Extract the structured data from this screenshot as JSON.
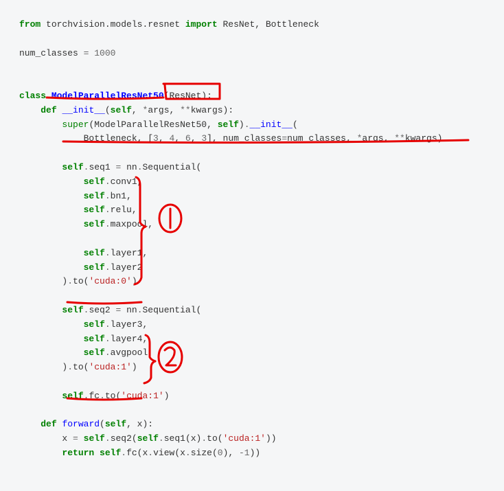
{
  "code": {
    "l1_from": "from",
    "l1_mod": " torchvision.models.resnet ",
    "l1_import": "import",
    "l1_names": " ResNet, Bottleneck",
    "l3_a": "num_classes ",
    "l3_eq": "=",
    "l3_sp": " ",
    "l3_v": "1000",
    "l6_class": "class",
    "l6_sp1": " ",
    "l6_name": "ModelParallelResNet50",
    "l6_paren_o": "(",
    "l6_base": "ResNet",
    "l6_paren_c": ")",
    "l6_colon": ":",
    "l7_indent": "    ",
    "l7_def": "def",
    "l7_sp": " ",
    "l7_init": "__init__",
    "l7_sig_o": "(",
    "l7_self": "self",
    "l7_rest": ", ",
    "l7_star": "*",
    "l7_args": "args, ",
    "l7_dstar": "**",
    "l7_kwargs": "kwargs):",
    "l8_indent": "        ",
    "l8_super": "super",
    "l8_po": "(",
    "l8_cls": "ModelParallelResNet50",
    "l8_mid": ", ",
    "l8_self": "self",
    "l8_pc": ")",
    "l8_dot": ".",
    "l8_init": "__init__",
    "l8_po2": "(",
    "l9_indent": "            ",
    "l9_bottle": "Bottleneck, [",
    "l9_n3": "3",
    "l9_c1": ", ",
    "l9_n4": "4",
    "l9_c2": ", ",
    "l9_n6": "6",
    "l9_c3": ", ",
    "l9_n3b": "3",
    "l9_close": "], num_classes",
    "l9_eq": "=",
    "l9_nc": "num_classes, ",
    "l9_star": "*",
    "l9_args": "args, ",
    "l9_dstar": "**",
    "l9_kwargs": "kwargs)",
    "l11_indent": "        ",
    "l11_self": "self",
    "l11_dot": ".",
    "l11_seq": "seq1 ",
    "l11_eq": "=",
    "l11_r": " nn",
    "l11_dot2": ".",
    "l11_seqfn": "Sequential(",
    "l12_i": "            ",
    "l12_self": "self",
    "l12_d": ".",
    "l12_a": "conv1,",
    "l13_i": "            ",
    "l13_self": "self",
    "l13_d": ".",
    "l13_a": "bn1,",
    "l14_i": "            ",
    "l14_self": "self",
    "l14_d": ".",
    "l14_a": "relu,",
    "l15_i": "            ",
    "l15_self": "self",
    "l15_d": ".",
    "l15_a": "maxpool,",
    "l17_i": "            ",
    "l17_self": "self",
    "l17_d": ".",
    "l17_a": "layer1,",
    "l18_i": "            ",
    "l18_self": "self",
    "l18_d": ".",
    "l18_a": "layer2",
    "l19_i": "        )",
    "l19_d": ".",
    "l19_to": "to(",
    "l19_s": "'cuda:0'",
    "l19_c": ")",
    "l21_i": "        ",
    "l21_self": "self",
    "l21_d": ".",
    "l21_seq": "seq2 ",
    "l21_eq": "=",
    "l21_r": " nn",
    "l21_d2": ".",
    "l21_seqfn": "Sequential(",
    "l22_i": "            ",
    "l22_self": "self",
    "l22_d": ".",
    "l22_a": "layer3,",
    "l23_i": "            ",
    "l23_self": "self",
    "l23_d": ".",
    "l23_a": "layer4,",
    "l24_i": "            ",
    "l24_self": "self",
    "l24_d": ".",
    "l24_a": "avgpool,",
    "l25_i": "        )",
    "l25_d": ".",
    "l25_to": "to(",
    "l25_s": "'cuda:1'",
    "l25_c": ")",
    "l27_i": "        ",
    "l27_self": "self",
    "l27_d": ".",
    "l27_fc": "fc",
    "l27_d2": ".",
    "l27_to": "to(",
    "l27_s": "'cuda:1'",
    "l27_c": ")",
    "l29_i": "    ",
    "l29_def": "def",
    "l29_sp": " ",
    "l29_fwd": "forward",
    "l29_po": "(",
    "l29_self": "self",
    "l29_rest": ", x):",
    "l30_i": "        ",
    "l30_x": "x ",
    "l30_eq": "=",
    "l30_sp": " ",
    "l30_self": "self",
    "l30_d": ".",
    "l30_s2": "seq2(",
    "l30_self2": "self",
    "l30_d2": ".",
    "l30_s1": "seq1(x)",
    "l30_d3": ".",
    "l30_to": "to(",
    "l30_str": "'cuda:1'",
    "l30_c": "))",
    "l31_i": "        ",
    "l31_ret": "return",
    "l31_sp": " ",
    "l31_self": "self",
    "l31_d": ".",
    "l31_fc": "fc(x",
    "l31_d2": ".",
    "l31_v": "view(x",
    "l31_d3": ".",
    "l31_sz": "size(",
    "l31_n0": "0",
    "l31_c1": "), ",
    "l31_neg": "-",
    "l31_n1": "1",
    "l31_c2": "))"
  },
  "annotations": {
    "label1": "1",
    "label2": "2"
  }
}
